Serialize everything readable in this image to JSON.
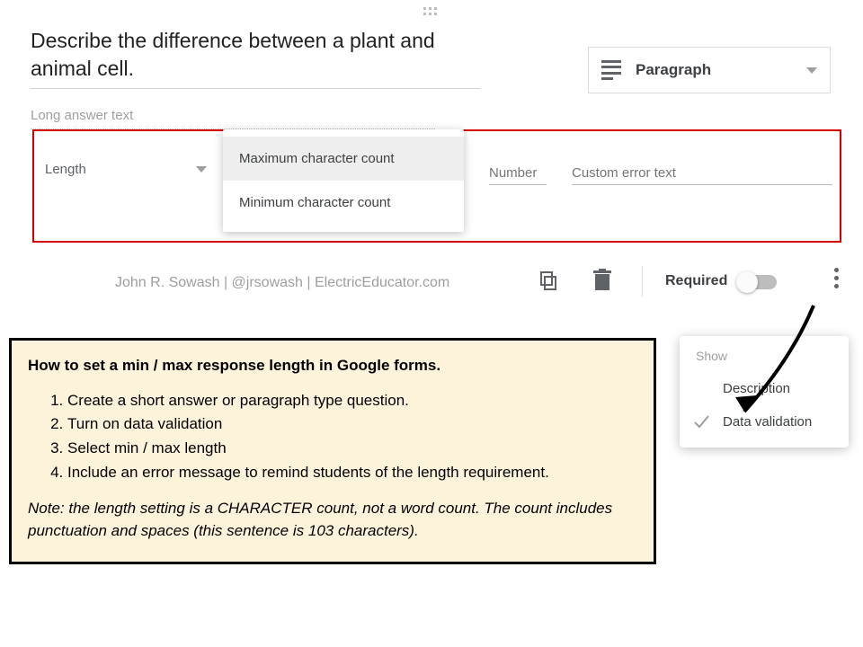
{
  "question_text": "Describe the difference between a plant and animal cell.",
  "question_type": {
    "label": "Paragraph"
  },
  "long_answer_placeholder": "Long answer text",
  "validation": {
    "select_label": "Length",
    "options": [
      "Maximum character count",
      "Minimum character count"
    ],
    "selected_index": 0,
    "number_placeholder": "Number",
    "error_placeholder": "Custom error text"
  },
  "attribution": "John R. Sowash | @jrsowash | ElectricEducator.com",
  "required_label": "Required",
  "popover": {
    "heading": "Show",
    "items": [
      {
        "label": "Description",
        "checked": false
      },
      {
        "label": "Data validation",
        "checked": true
      }
    ]
  },
  "help": {
    "title": "How to set a min / max response length in Google forms.",
    "steps": [
      "Create a short answer or paragraph type question.",
      "Turn on data validation",
      "Select min / max length",
      "Include an error message to remind students of the length requirement."
    ],
    "note": "Note: the length setting is a CHARACTER count, not a word count. The count includes punctuation and spaces (this sentence is 103 characters)."
  }
}
